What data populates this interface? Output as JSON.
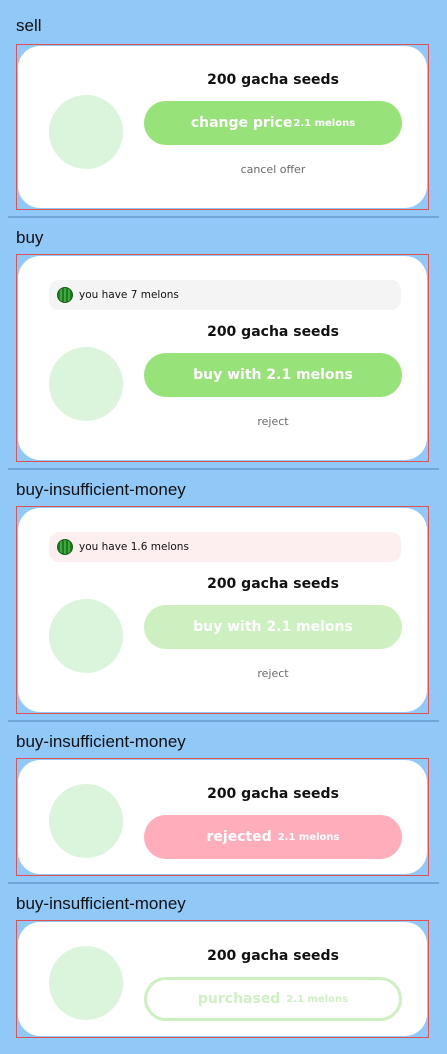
{
  "sections": {
    "sell": {
      "title": "sell",
      "item": "200 gacha seeds",
      "button_label": "change price",
      "button_price": "2.1 melons",
      "link": "cancel offer"
    },
    "buy": {
      "title": "buy",
      "balance": "you have 7 melons",
      "item": "200 gacha seeds",
      "button_label": "buy with 2.1 melons",
      "link": "reject"
    },
    "buy_insufficient": {
      "title": "buy-insufficient-money",
      "balance": "you have 1.6 melons",
      "item": "200 gacha seeds",
      "button_label": "buy with 2.1 melons",
      "link": "reject"
    },
    "rejected": {
      "title": "buy-insufficient-money",
      "item": "200 gacha seeds",
      "button_label": "rejected",
      "button_price": "2.1 melons"
    },
    "purchased": {
      "title": "buy-insufficient-money",
      "item": "200 gacha seeds",
      "button_label": "purchased",
      "button_price": "2.1 melons"
    }
  },
  "icons": {
    "currency": "watermelon-icon"
  },
  "colors": {
    "background": "#90c8f8",
    "primary_green": "#98e27a",
    "disabled_green": "#cdf0c0",
    "rejected_pink": "#ffadba",
    "warning_bg": "#fdeeef",
    "frame_border": "#e05252"
  }
}
